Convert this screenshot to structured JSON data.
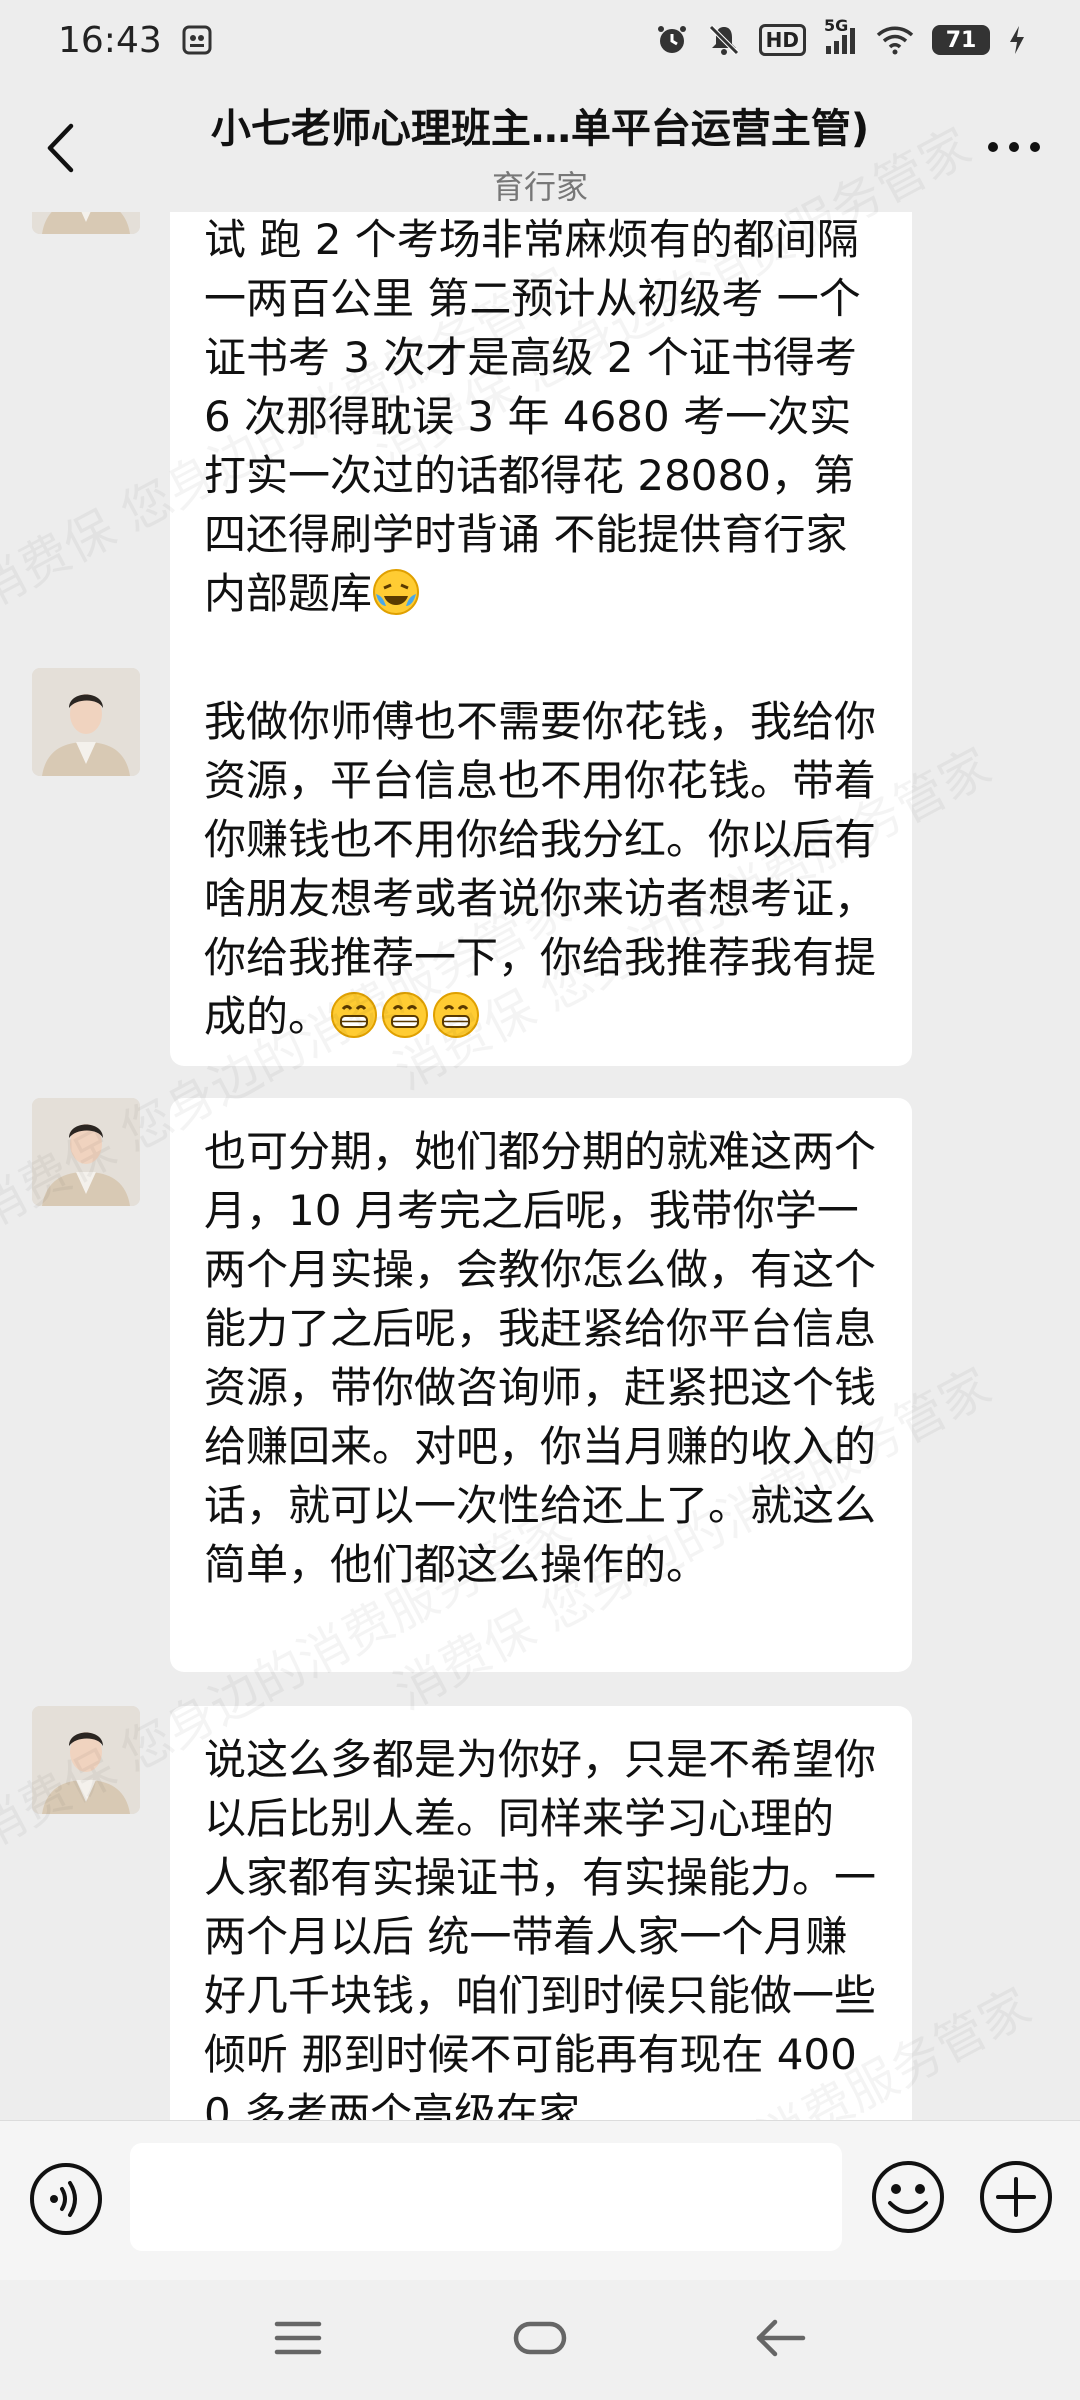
{
  "status_bar": {
    "time": "16:43",
    "network_label": "5G",
    "hd_label": "HD",
    "battery": "71"
  },
  "header": {
    "title": "小七老师心理班主…单平台运营主管)",
    "subtitle": "育行家"
  },
  "messages": [
    {
      "text": "试 跑 2 个考场非常麻烦有的都间隔一两百公里  第二预计从初级考 一个证书考 3 次才是高级 2 个证书得考 6 次那得耽误 3 年    4680 考一次实打实一次过的话都得花 28080，第四还得刷学时背诵 不能提供育行家内部题库",
      "emoji": "😭"
    },
    {
      "text": "我做你师傅也不需要你花钱，我给你资源，平台信息也不用你花钱。带着你赚钱也不用你给我分红。你以后有啥朋友想考或者说你来访者想考证，你给我推荐一下，你给我推荐我有提成的。",
      "emoji": "😁😁😁"
    },
    {
      "text": "也可分期，她们都分期的就难这两个月，10 月考完之后呢，我带你学一两个月实操，会教你怎么做，有这个能力了之后呢，我赶紧给你平台信息资源，带你做咨询师，赶紧把这个钱给赚回来。对吧，你当月赚的收入的话，就可以一次性给还上了。就这么简单，他们都这么操作的。",
      "emoji": ""
    },
    {
      "text": "说这么多都是为你好，只是不希望你以后比别人差。同样来学习心理的 人家都有实操证书，有实操能力。一两个月以后 统一带着人家一个月赚好几千块钱，咱们到时候只能做一些倾听 那到时候不可能再有现在 4000 多考两个高级在家",
      "emoji": ""
    }
  ],
  "watermark": {
    "text": "消费保 您身边的消费服务管家"
  },
  "input": {
    "placeholder": ""
  },
  "colors": {
    "background": "#ededed",
    "bubble": "#ffffff",
    "input_bar": "#f5f5f5"
  },
  "icons": {
    "back": "chevron-left-icon",
    "more": "more-dots-icon",
    "voice": "voice-icon",
    "emoji": "smiley-icon",
    "plus": "plus-icon"
  }
}
